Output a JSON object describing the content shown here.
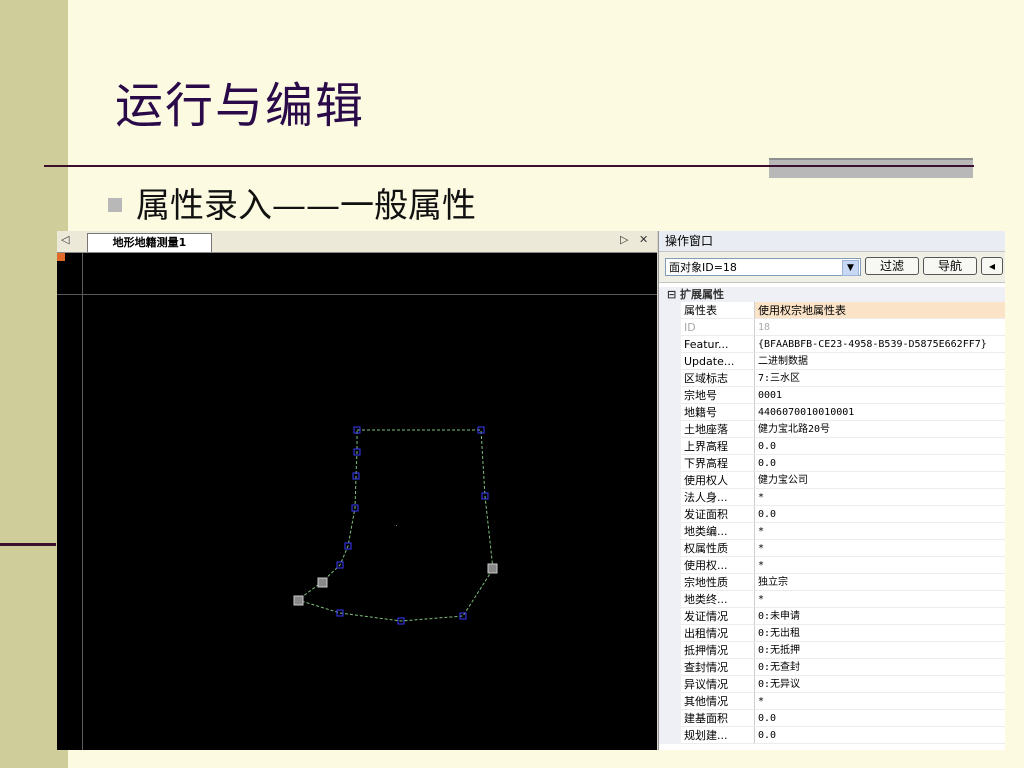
{
  "slide": {
    "title": "运行与编辑",
    "bullet": "属性录入——一般属性"
  },
  "doc": {
    "tab_label": "地形地籍测量1",
    "left_arrow": "◁",
    "right_arrow": "▷",
    "close": "✕"
  },
  "ops": {
    "title": "操作窗口",
    "object_select": "面对象ID=18",
    "filter_label": "过滤",
    "nav_label": "导航",
    "more_label": "◂",
    "category": "⊟ 扩展属性",
    "rows": [
      {
        "name": "属性表",
        "value": "使用权宗地属性表"
      },
      {
        "name": "ID",
        "value": "18"
      },
      {
        "name": "Featur...",
        "value": "{BFAABBFB-CE23-4958-B539-D5875E662FF7}"
      },
      {
        "name": "Update...",
        "value": "二进制数据"
      },
      {
        "name": "区域标志",
        "value": "7:三水区"
      },
      {
        "name": "宗地号",
        "value": "0001"
      },
      {
        "name": "地籍号",
        "value": "4406070010010001"
      },
      {
        "name": "土地座落",
        "value": "健力宝北路20号"
      },
      {
        "name": "上界高程",
        "value": "0.0"
      },
      {
        "name": "下界高程",
        "value": "0.0"
      },
      {
        "name": "使用权人",
        "value": "健力宝公司"
      },
      {
        "name": "法人身...",
        "value": "*"
      },
      {
        "name": "发证面积",
        "value": "0.0"
      },
      {
        "name": "地类编...",
        "value": "*"
      },
      {
        "name": "权属性质",
        "value": "*"
      },
      {
        "name": "使用权...",
        "value": "*"
      },
      {
        "name": "宗地性质",
        "value": "独立宗"
      },
      {
        "name": "地类终...",
        "value": "*"
      },
      {
        "name": "发证情况",
        "value": "0:未申请"
      },
      {
        "name": "出租情况",
        "value": "0:无出租"
      },
      {
        "name": "抵押情况",
        "value": "0:无抵押"
      },
      {
        "name": "查封情况",
        "value": "0:无查封"
      },
      {
        "name": "异议情况",
        "value": "0:无异议"
      },
      {
        "name": "其他情况",
        "value": "*"
      },
      {
        "name": "建基面积",
        "value": "0.0"
      },
      {
        "name": "规划建...",
        "value": "0.0"
      }
    ]
  },
  "colors": {
    "slide_bg": "#fcfbe2",
    "title": "#2a0a48",
    "map_bg": "#000000",
    "polygon_line": "#7dbf7d",
    "vertex": "#3a3aff",
    "selected_row": "#fbe3c8"
  }
}
